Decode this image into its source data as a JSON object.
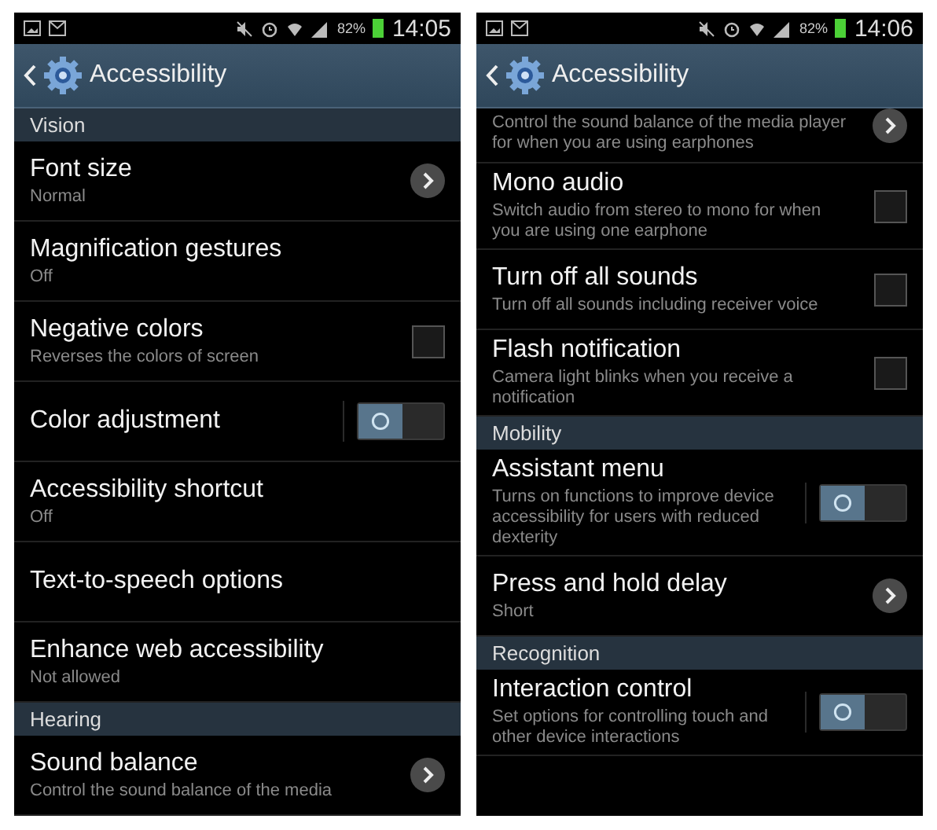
{
  "screens": [
    {
      "status_bar": {
        "battery": "82%",
        "time": "14:05"
      },
      "action_bar": {
        "title": "Accessibility"
      },
      "items": [
        {
          "kind": "header",
          "label": "Vision"
        },
        {
          "kind": "chevron",
          "title": "Font size",
          "subtitle": "Normal"
        },
        {
          "kind": "plain",
          "title": "Magnification gestures",
          "subtitle": "Off"
        },
        {
          "kind": "checkbox",
          "title": "Negative colors",
          "subtitle": "Reverses the colors of screen",
          "checked": false
        },
        {
          "kind": "toggle",
          "title": "Color adjustment",
          "on": false
        },
        {
          "kind": "plain",
          "title": "Accessibility shortcut",
          "subtitle": "Off"
        },
        {
          "kind": "plain",
          "title": "Text-to-speech options"
        },
        {
          "kind": "plain",
          "title": "Enhance web accessibility",
          "subtitle": "Not allowed"
        },
        {
          "kind": "header",
          "label": "Hearing"
        },
        {
          "kind": "chevron",
          "title": "Sound balance",
          "subtitle": "Control the sound balance of the media"
        }
      ]
    },
    {
      "status_bar": {
        "battery": "82%",
        "time": "14:06"
      },
      "action_bar": {
        "title": "Accessibility"
      },
      "items": [
        {
          "kind": "chevron",
          "subtitle": "Control the sound balance of the media player for when you are using earphones"
        },
        {
          "kind": "checkbox",
          "title": "Mono audio",
          "subtitle": "Switch audio from stereo to mono for when you are using one earphone",
          "checked": false
        },
        {
          "kind": "checkbox",
          "title": "Turn off all sounds",
          "subtitle": "Turn off all sounds including receiver voice",
          "checked": false
        },
        {
          "kind": "checkbox",
          "title": "Flash notification",
          "subtitle": "Camera light blinks when you receive a notification",
          "checked": false
        },
        {
          "kind": "header",
          "label": "Mobility"
        },
        {
          "kind": "toggle",
          "title": "Assistant menu",
          "subtitle": "Turns on functions to improve device accessibility for users with reduced dexterity",
          "on": false
        },
        {
          "kind": "chevron",
          "title": "Press and hold delay",
          "subtitle": "Short"
        },
        {
          "kind": "header",
          "label": "Recognition"
        },
        {
          "kind": "toggle",
          "title": "Interaction control",
          "subtitle": "Set options for controlling touch and other device interactions",
          "on": false
        }
      ]
    }
  ]
}
